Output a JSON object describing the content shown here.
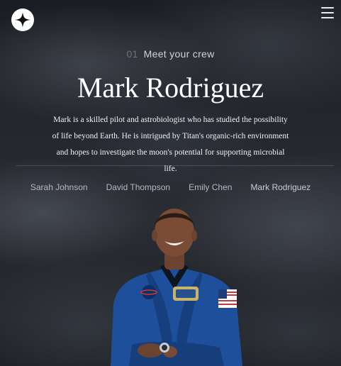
{
  "header": {
    "logo_icon": "star-logo-icon",
    "menu_icon": "hamburger-menu-icon"
  },
  "section": {
    "number": "01",
    "label": "Meet your crew"
  },
  "crew_member": {
    "name": "Mark Rodriguez",
    "bio": "Mark is a skilled pilot and astrobiologist who has studied the possibility of life beyond Earth. He is intrigued by Titan's organic-rich environment and hopes to investigate the moon's potential for supporting microbial life.",
    "portrait_icon": "astronaut-portrait"
  },
  "crew_nav": [
    {
      "label": "Sarah Johnson",
      "active": false
    },
    {
      "label": "David Thompson",
      "active": false
    },
    {
      "label": "Emily Chen",
      "active": false
    },
    {
      "label": "Mark Rodriguez",
      "active": true
    }
  ],
  "colors": {
    "background": "#24272e",
    "text": "#ffffff",
    "muted": "#6e727c",
    "suit_blue": "#1d4f9a"
  }
}
